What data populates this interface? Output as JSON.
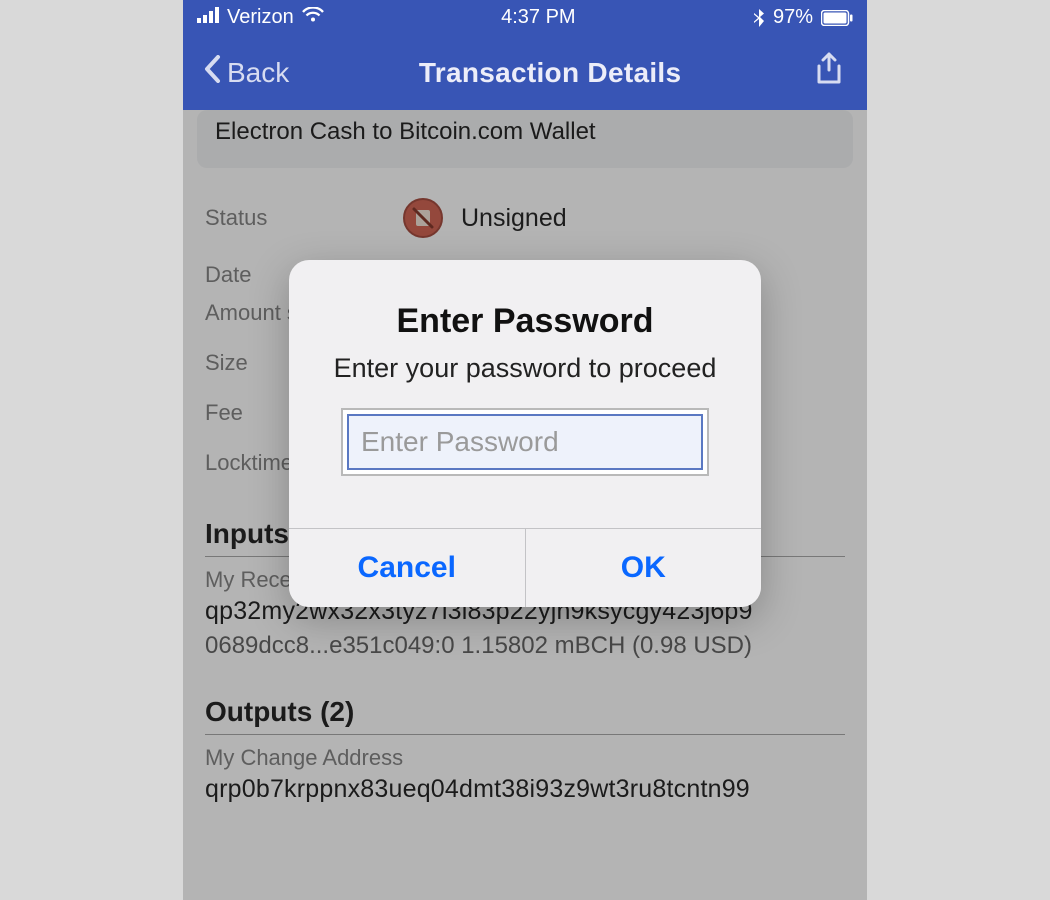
{
  "statusbar": {
    "carrier": "Verizon",
    "time": "4:37 PM",
    "battery": "97%"
  },
  "nav": {
    "back": "Back",
    "title": "Transaction Details"
  },
  "description": "Electron Cash to Bitcoin.com Wallet",
  "fields": {
    "status_label": "Status",
    "status_value": "Unsigned",
    "date_label": "Date",
    "amount_label": "Amount se",
    "size_label": "Size",
    "fee_label": "Fee",
    "locktime_label": "Locktime"
  },
  "inputs": {
    "heading": "Inputs (",
    "receive_label": "My Receiv",
    "address": "qp32my2wx32x3tyz7l3l83p22yjn9ksycgy423j6p9",
    "meta": "0689dcc8...e351c049:0   1.15802 mBCH (0.98 USD)"
  },
  "outputs": {
    "heading": "Outputs (2)",
    "change_label": "My Change Address",
    "address": "qrp0b7krppnx83ueq04dmt38i93z9wt3ru8tcntn99"
  },
  "alert": {
    "title": "Enter Password",
    "message": "Enter your password to proceed",
    "placeholder": "Enter Password",
    "cancel": "Cancel",
    "ok": "OK"
  }
}
